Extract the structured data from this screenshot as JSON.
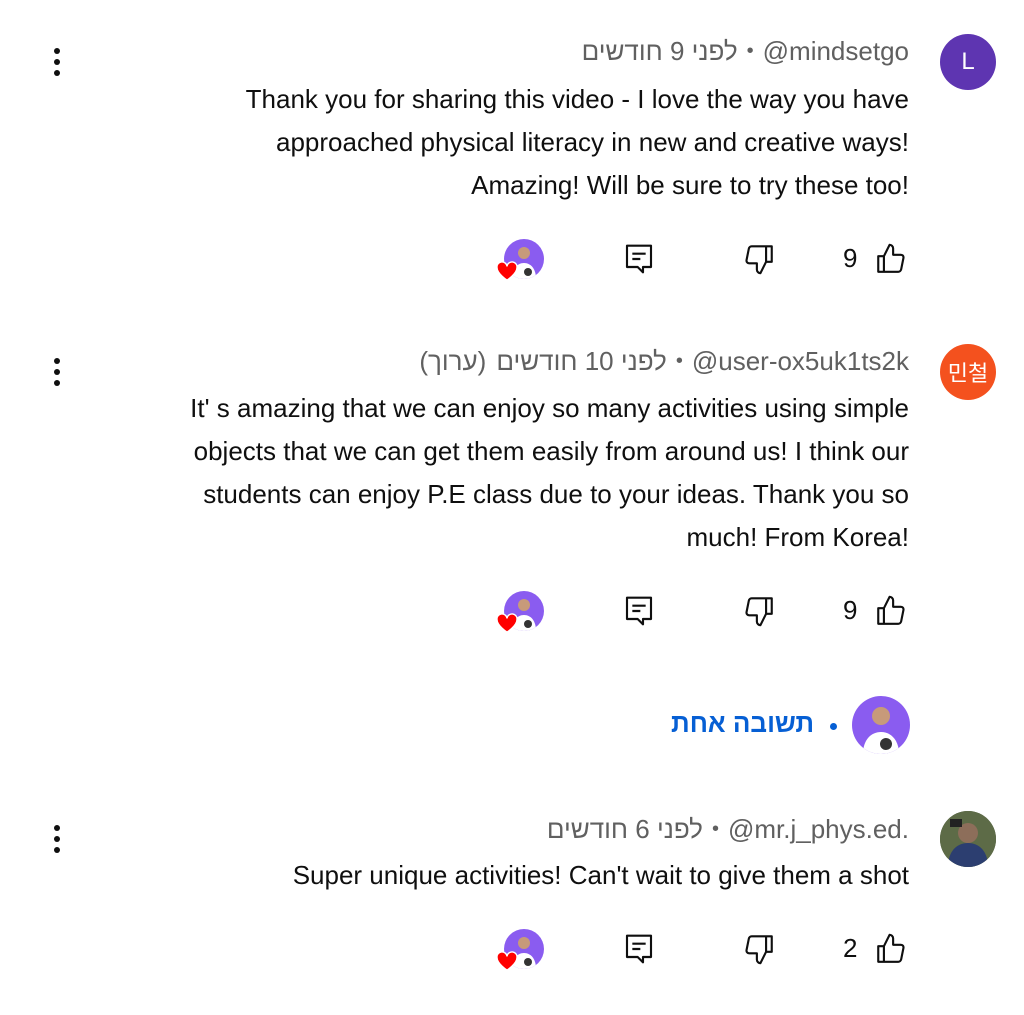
{
  "comments": [
    {
      "handle": "@mindsetgo",
      "time": "לפני 9 חודשים",
      "edited": "",
      "avatar_letter": "L",
      "avatar_color": "#5e35b1",
      "lines": [
        "Thank you for sharing this video - I love the way you have",
        "approached physical literacy in new and creative ways!",
        "Amazing! Will be sure to try these too!"
      ],
      "likes": "9"
    },
    {
      "handle": "@user-ox5uk1ts2k",
      "time": "לפני 10 חודשים",
      "edited": "(ערוך)",
      "avatar_letter": "민철",
      "avatar_color": "#f4511e",
      "lines": [
        "It' s amazing that we can enjoy so many activities using simple",
        "objects that we can get them easily from around us! I think our",
        "students can enjoy P.E class due to your ideas. Thank you so",
        "much! From Korea!"
      ],
      "likes": "9"
    },
    {
      "handle": "@mr.j_phys.ed.",
      "time": "לפני 6 חודשים",
      "edited": "",
      "avatar_letter": "",
      "avatar_color": "#4a5a3a",
      "lines": [
        "Super unique activities! Can't wait to give them a shot"
      ],
      "likes": "2"
    }
  ],
  "replies_label": "תשובה אחת",
  "colors": {
    "link_blue": "#065fd4",
    "heart_red": "#ff0000",
    "creator_avatar": "#8a5cf0"
  },
  "icons": {
    "like": "thumb-up-icon",
    "dislike": "thumb-down-icon",
    "reply": "reply-icon",
    "more": "more-vert-icon",
    "heart": "creator-heart-icon"
  }
}
